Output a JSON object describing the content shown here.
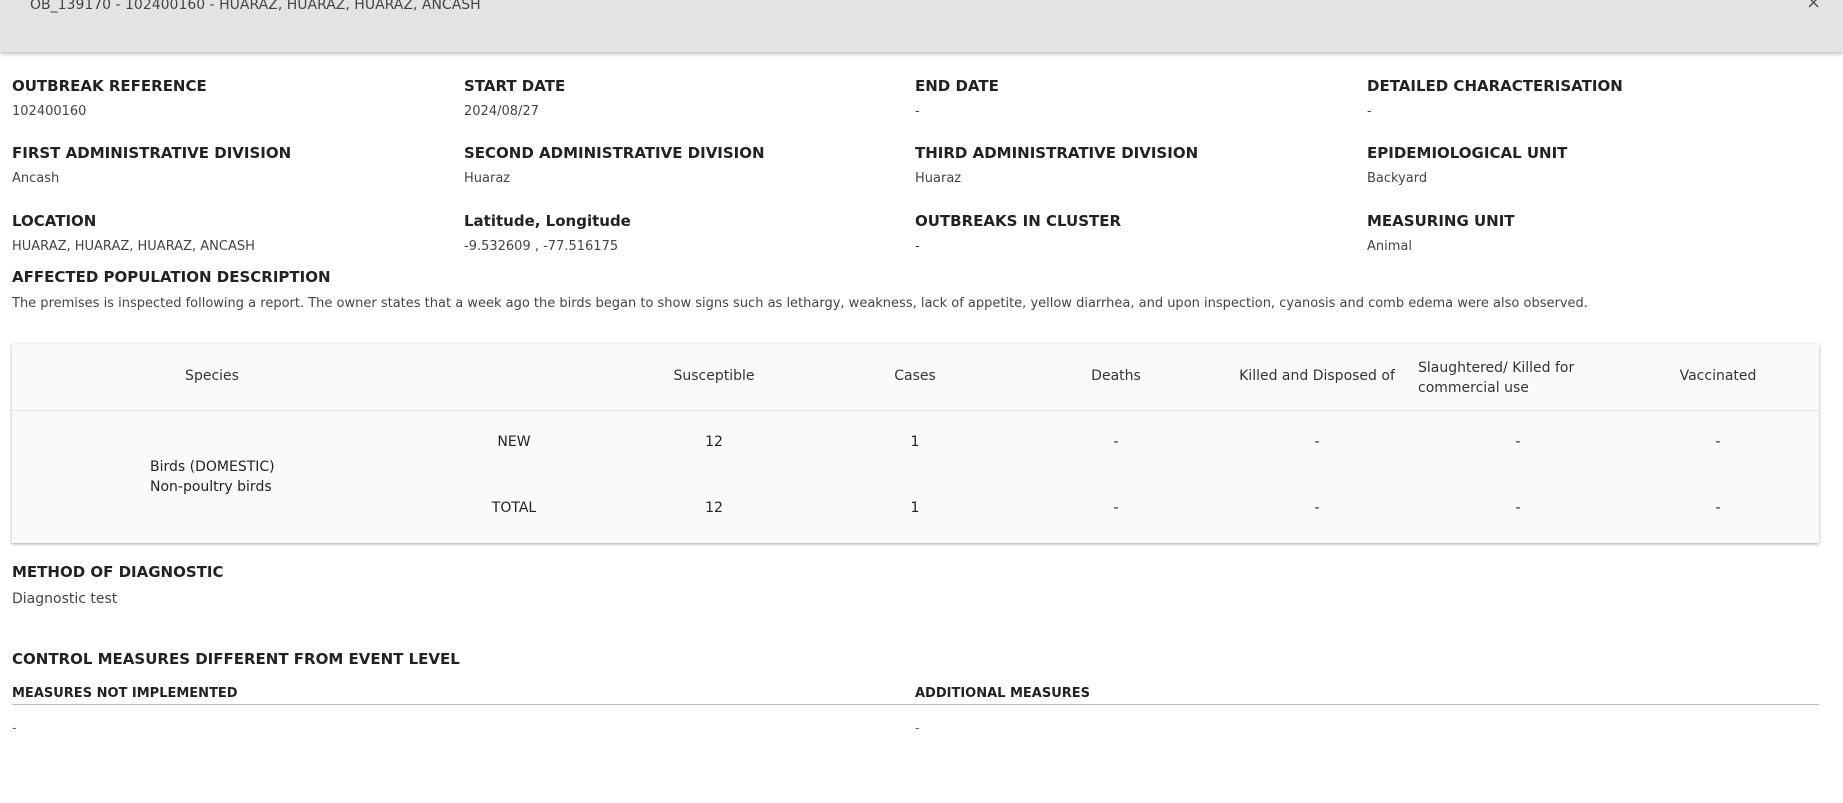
{
  "header": {
    "title": "OB_139170 - 102400160 - HUARAZ, HUARAZ, HUARAZ, ANCASH",
    "close_glyph": "×"
  },
  "fields": [
    {
      "label": "OUTBREAK REFERENCE",
      "value": "102400160"
    },
    {
      "label": "START DATE",
      "value": "2024/08/27"
    },
    {
      "label": "END DATE",
      "value": "-"
    },
    {
      "label": "DETAILED CHARACTERISATION",
      "value": "-"
    },
    {
      "label": "FIRST ADMINISTRATIVE DIVISION",
      "value": "Ancash"
    },
    {
      "label": "SECOND ADMINISTRATIVE DIVISION",
      "value": "Huaraz"
    },
    {
      "label": "THIRD ADMINISTRATIVE DIVISION",
      "value": "Huaraz"
    },
    {
      "label": "EPIDEMIOLOGICAL UNIT",
      "value": "Backyard"
    },
    {
      "label": "LOCATION",
      "value": "HUARAZ, HUARAZ, HUARAZ, ANCASH"
    },
    {
      "label": "Latitude, Longitude",
      "value": "-9.532609 , -77.516175"
    },
    {
      "label": "OUTBREAKS IN CLUSTER",
      "value": "-"
    },
    {
      "label": "MEASURING UNIT",
      "value": "Animal"
    }
  ],
  "affected_population": {
    "label": "AFFECTED POPULATION DESCRIPTION",
    "text": "The premises is inspected following a report. The owner states that a week ago the birds began to show signs such as lethargy, weakness, lack of appetite, yellow diarrhea, and upon inspection, cyanosis and comb edema were also observed."
  },
  "table": {
    "headers": {
      "species": "Species",
      "susceptible": "Susceptible",
      "cases": "Cases",
      "deaths": "Deaths",
      "killed_disposed": "Killed and Disposed of",
      "slaughtered_line1": "Slaughtered/ Killed for",
      "slaughtered_line2": "commercial use",
      "vaccinated": "Vaccinated"
    },
    "species_line1": "Birds (DOMESTIC)",
    "species_line2": "Non-poultry birds",
    "rows": [
      {
        "type": "NEW",
        "susceptible": "12",
        "cases": "1",
        "deaths": "-",
        "killed_disposed": "-",
        "slaughtered": "-",
        "vaccinated": "-"
      },
      {
        "type": "TOTAL",
        "susceptible": "12",
        "cases": "1",
        "deaths": "-",
        "killed_disposed": "-",
        "slaughtered": "-",
        "vaccinated": "-"
      }
    ]
  },
  "diagnostic": {
    "label": "METHOD OF DIAGNOSTIC",
    "value": "Diagnostic test"
  },
  "control_measures": {
    "label": "CONTROL MEASURES DIFFERENT FROM EVENT LEVEL",
    "not_implemented_label": "MEASURES NOT IMPLEMENTED",
    "not_implemented_value": "-",
    "additional_label": "ADDITIONAL MEASURES",
    "additional_value": "-"
  }
}
